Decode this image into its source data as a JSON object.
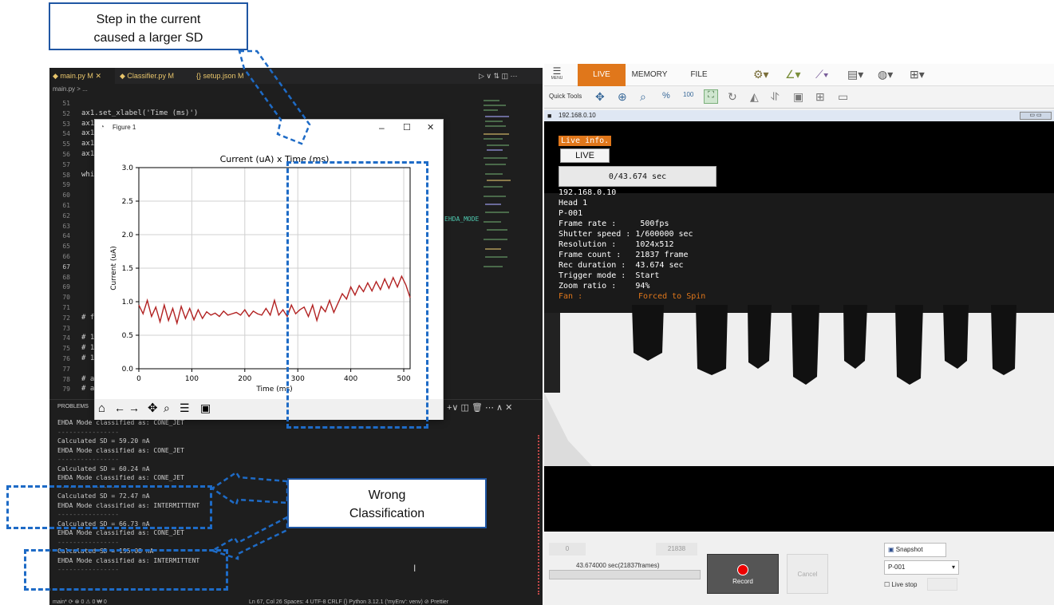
{
  "annotations": {
    "top_note": "Step in the current\ncaused a larger SD",
    "wrong_label": "Wrong\nClassification"
  },
  "vscode": {
    "tabs": [
      "main.py M",
      "Classifier.py M",
      "{} setup.json M"
    ],
    "breadcrumb": "main.py > ...",
    "code_lines": [
      {
        "n": "51",
        "t": ""
      },
      {
        "n": "52",
        "t": "ax1.set_xlabel('Time (ms)')"
      },
      {
        "n": "53",
        "t": "ax1"
      },
      {
        "n": "54",
        "t": "ax1"
      },
      {
        "n": "55",
        "t": "ax1"
      },
      {
        "n": "56",
        "t": "ax1"
      },
      {
        "n": "57",
        "t": ""
      },
      {
        "n": "58",
        "t": "whi"
      },
      {
        "n": "59",
        "t": ""
      },
      {
        "n": "60",
        "t": ""
      },
      {
        "n": "61",
        "t": ""
      },
      {
        "n": "62",
        "t": ""
      },
      {
        "n": "63",
        "t": ""
      },
      {
        "n": "64",
        "t": ""
      },
      {
        "n": "65",
        "t": ""
      },
      {
        "n": "66",
        "t": ""
      },
      {
        "n": "67",
        "t": ""
      },
      {
        "n": "68",
        "t": ""
      },
      {
        "n": "69",
        "t": ""
      },
      {
        "n": "70",
        "t": ""
      },
      {
        "n": "71",
        "t": ""
      },
      {
        "n": "72",
        "t": "# f"
      },
      {
        "n": "73",
        "t": ""
      },
      {
        "n": "74",
        "t": "# 1"
      },
      {
        "n": "75",
        "t": "# 1"
      },
      {
        "n": "76",
        "t": "# 1"
      },
      {
        "n": "77",
        "t": ""
      },
      {
        "n": "78",
        "t": "# a"
      },
      {
        "n": "79",
        "t": "# a"
      }
    ],
    "right_code_fragment": "EHDA_MODE",
    "panel_label": "PROBLEMS",
    "terminal_lines": [
      "EHDA Mode classified as: CONE_JET",
      "----------------",
      "Calculated SD = 59.20 nA",
      "EHDA Mode classified as: CONE_JET",
      "----------------",
      "Calculated SD = 60.24 nA",
      "EHDA Mode classified as: CONE_JET",
      "----------------",
      "Calculated SD = 72.47 nA",
      "EHDA Mode classified as: INTERMITTENT",
      "----------------",
      "Calculated SD = 66.73 nA",
      "EHDA Mode classified as: CONE_JET",
      "----------------",
      "Calculated SD = 195.08 nA",
      "EHDA Mode classified as: INTERMITTENT",
      "----------------"
    ],
    "status": {
      "left": "main* ⟳  ⊗ 0 ⚠ 0  ₩ 0",
      "right": "Ln 67, Col 26   Spaces: 4   UTF-8   CRLF   {} Python   3.12.1 ('myEnv': venv)   ⊘ Prettier"
    }
  },
  "figure": {
    "window_title": "Figure 1",
    "chart_data": {
      "type": "line",
      "title": "Current (uA) x Time (ms)",
      "xlabel": "Time (ms)",
      "ylabel": "Current (uA)",
      "xlim": [
        0,
        512
      ],
      "ylim": [
        0.0,
        3.0
      ],
      "xticks": [
        0,
        100,
        200,
        300,
        400,
        500
      ],
      "yticks": [
        0.0,
        0.5,
        1.0,
        1.5,
        2.0,
        2.5,
        3.0
      ],
      "grid": true,
      "line_color": "#b22222",
      "x": [
        0,
        8,
        16,
        24,
        32,
        40,
        48,
        56,
        64,
        72,
        80,
        88,
        96,
        104,
        112,
        120,
        128,
        136,
        144,
        152,
        160,
        168,
        176,
        184,
        192,
        200,
        208,
        216,
        224,
        232,
        240,
        248,
        256,
        264,
        272,
        280,
        288,
        296,
        304,
        312,
        320,
        328,
        336,
        344,
        352,
        360,
        368,
        376,
        384,
        392,
        400,
        408,
        416,
        424,
        432,
        440,
        448,
        456,
        464,
        472,
        480,
        488,
        496,
        504,
        512
      ],
      "values": [
        0.95,
        0.82,
        1.02,
        0.78,
        0.92,
        0.7,
        0.95,
        0.72,
        0.9,
        0.68,
        0.93,
        0.75,
        0.9,
        0.73,
        0.88,
        0.75,
        0.85,
        0.8,
        0.83,
        0.78,
        0.86,
        0.8,
        0.82,
        0.84,
        0.8,
        0.88,
        0.78,
        0.86,
        0.82,
        0.8,
        0.9,
        0.8,
        1.02,
        0.8,
        0.88,
        0.78,
        0.95,
        0.82,
        0.88,
        0.92,
        0.78,
        0.95,
        0.72,
        0.93,
        0.85,
        1.02,
        0.84,
        0.98,
        1.12,
        1.04,
        1.22,
        1.1,
        1.24,
        1.15,
        1.28,
        1.16,
        1.3,
        1.18,
        1.34,
        1.2,
        1.36,
        1.22,
        1.38,
        1.25,
        1.06
      ]
    }
  },
  "camera": {
    "menu_label": "MENU",
    "tabs": [
      "LIVE",
      "MEMORY",
      "FILE"
    ],
    "active_tab": "LIVE",
    "accent": "#e0771b",
    "quick_tools_label": "Quick Tools",
    "ip_title": "192.168.0.10",
    "overlay": {
      "live_info": "Live info.",
      "live_button": "LIVE",
      "progress": "0/43.674 sec",
      "lines": [
        "192.168.0.10",
        "Head 1",
        "P-001",
        "Frame rate :     500fps",
        "Shutter speed : 1/600000 sec",
        "Resolution :    1024x512",
        "Frame count :   21837 frame",
        "Rec duration :  43.674 sec",
        "Trigger mode :  Start",
        "Zoom ratio :    94%"
      ],
      "fan_label": "Fan :",
      "fan_value": "Forced to Spin"
    },
    "bottom": {
      "start_frame": "0",
      "end_frame": "21838",
      "duration": "43.674000 sec(21837frames)",
      "record_label": "Record",
      "cancel_label": "Cancel",
      "snapshot_label": "Snapshot",
      "profile_value": "P-001",
      "live_stop_label": "Live stop"
    }
  }
}
